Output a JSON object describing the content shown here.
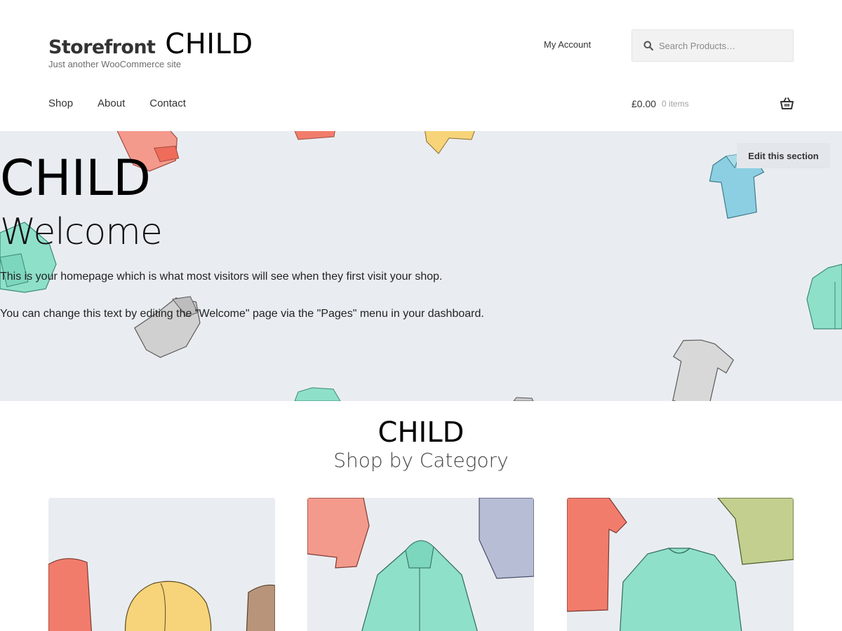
{
  "header": {
    "brand": "Storefront",
    "brand_suffix": "CHILD",
    "tagline": "Just another WooCommerce site",
    "my_account": "My Account",
    "search_placeholder": "Search Products…",
    "nav": [
      "Shop",
      "About",
      "Contact"
    ],
    "cart_amount": "£0.00",
    "cart_count": "0 items"
  },
  "hero": {
    "child": "CHILD",
    "title": "Welcome",
    "paragraph_1": "This is your homepage which is what most visitors will see when they first visit your shop.",
    "paragraph_2": "You can change this text by editing the \"Welcome\" page via the \"Pages\" menu in your dashboard.",
    "edit_button": "Edit this section"
  },
  "categories": {
    "child": "CHILD",
    "title": "Shop by Category"
  },
  "colors": {
    "hero_bg": "#e9edf1",
    "coral": "#f27c6c",
    "mint": "#7dd6be",
    "sky": "#8ccfe2",
    "grey": "#c9c9c9",
    "yellow": "#f7d47a",
    "lavender": "#b7bdd4",
    "olive": "#c2cf8e"
  },
  "icons": [
    "search-icon",
    "basket-icon"
  ]
}
